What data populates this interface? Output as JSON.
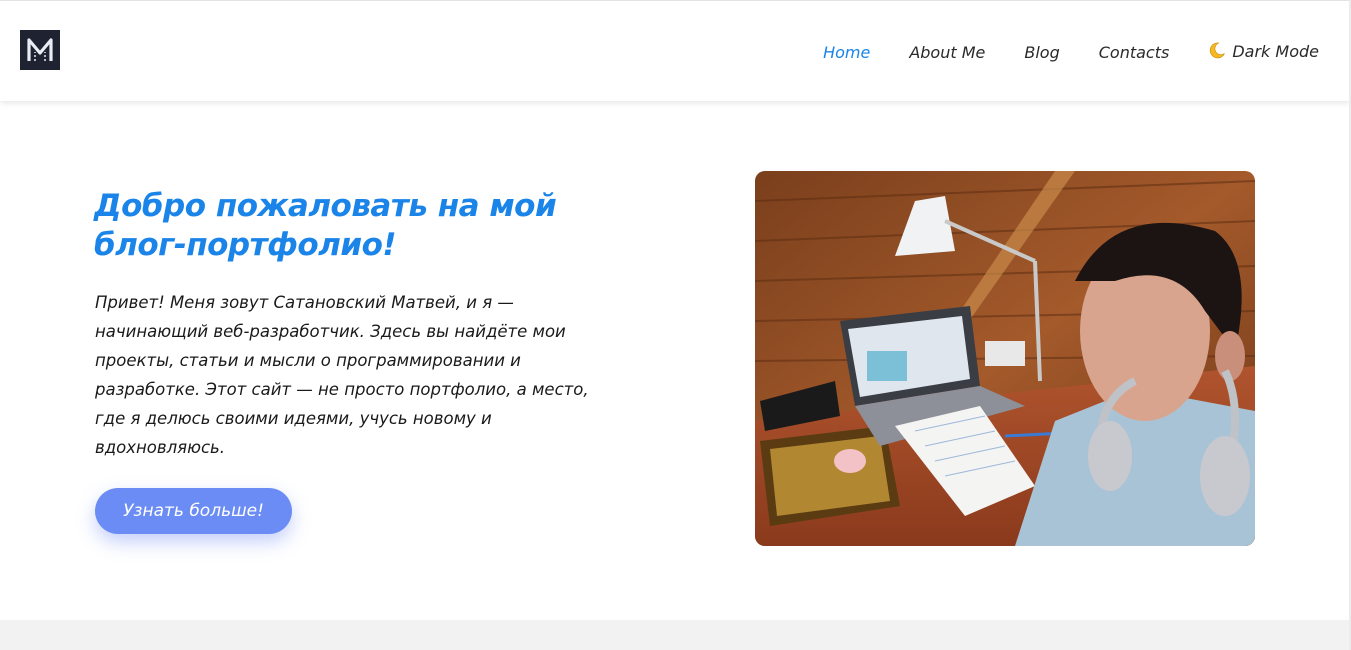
{
  "header": {
    "logo_letter": "M",
    "nav": [
      {
        "label": "Home",
        "active": true
      },
      {
        "label": "About Me",
        "active": false
      },
      {
        "label": "Blog",
        "active": false
      },
      {
        "label": "Contacts",
        "active": false
      }
    ],
    "theme_toggle": {
      "icon": "moon-icon",
      "label": "Dark Mode"
    }
  },
  "hero": {
    "title": "Добро пожаловать на мой блог-портфолио!",
    "text": "Привет! Меня зовут Сатановский Матвей, и я — начинающий веб-разработчик. Здесь вы найдёте мои проекты, статьи и мысли о программировании и разработке. Этот сайт — не просто портфолио, а место, где я делюсь своими идеями, учусь новому и вдохновляюсь.",
    "button_label": "Узнать больше!",
    "photo": "photo of a boy with headphones at a desk with a laptop"
  },
  "colors": {
    "accent": "#1a84e8",
    "button": "#6a8cf4",
    "logo_bg": "#1f2230"
  }
}
